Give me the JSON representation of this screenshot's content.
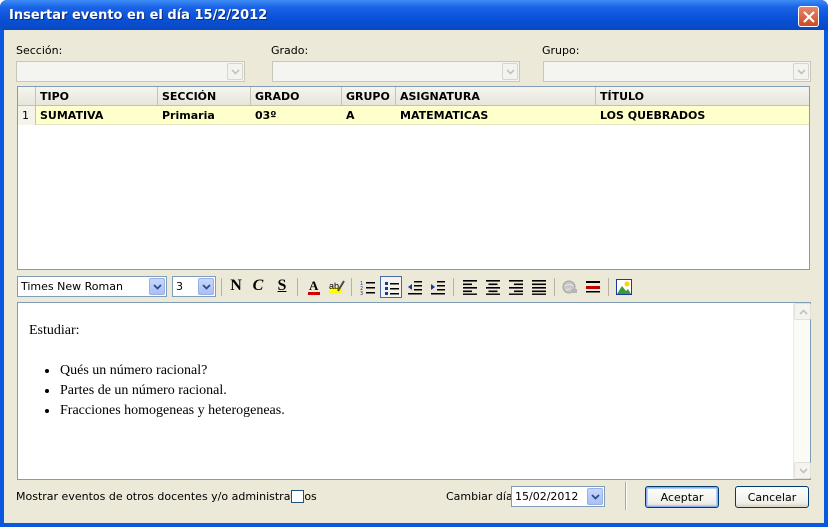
{
  "window": {
    "title": "Insertar evento en el día 15/2/2012"
  },
  "filters": {
    "seccion_label": "Sección:",
    "grado_label": "Grado:",
    "grupo_label": "Grupo:",
    "seccion_value": "",
    "grado_value": "",
    "grupo_value": ""
  },
  "grid": {
    "columns": [
      "TIPO",
      "SECCIÓN",
      "GRADO",
      "GRUPO",
      "ASIGNATURA",
      "TÍTULO"
    ],
    "rows": [
      {
        "num": "1",
        "tipo": "SUMATIVA",
        "seccion": "Primaria",
        "grado": "03º",
        "grupo": "A",
        "asignatura": "MATEMATICAS",
        "titulo": "LOS QUEBRADOS"
      }
    ],
    "row_highlight_color": "#ffffcc"
  },
  "toolbar": {
    "font_name": "Times New Roman",
    "font_size": "3",
    "bold_label": "N",
    "italic_label": "C",
    "strike_label": "S",
    "icons": [
      "font-color-icon",
      "highlight-icon",
      "numbered-list-icon",
      "bulleted-list-icon",
      "outdent-icon",
      "indent-icon",
      "align-left-icon",
      "align-center-icon",
      "align-right-icon",
      "justify-icon",
      "link-icon",
      "horizontal-rule-icon",
      "insert-image-icon"
    ]
  },
  "editor": {
    "heading": "Estudiar:",
    "items": [
      "Qués un número racional?",
      "Partes de un número racional.",
      "Fracciones homogeneas y heterogeneas."
    ]
  },
  "footer": {
    "show_others_label": "Mostrar eventos de otros docentes y/o administrativos",
    "show_others_checked": false,
    "change_day_label": "Cambiar día:",
    "date_value": "15/02/2012",
    "accept_label": "Aceptar",
    "cancel_label": "Cancelar"
  },
  "colors": {
    "titlebar": "#0a52d8",
    "dialog_bg": "#ece9d8",
    "close_button": "#c94a28"
  }
}
